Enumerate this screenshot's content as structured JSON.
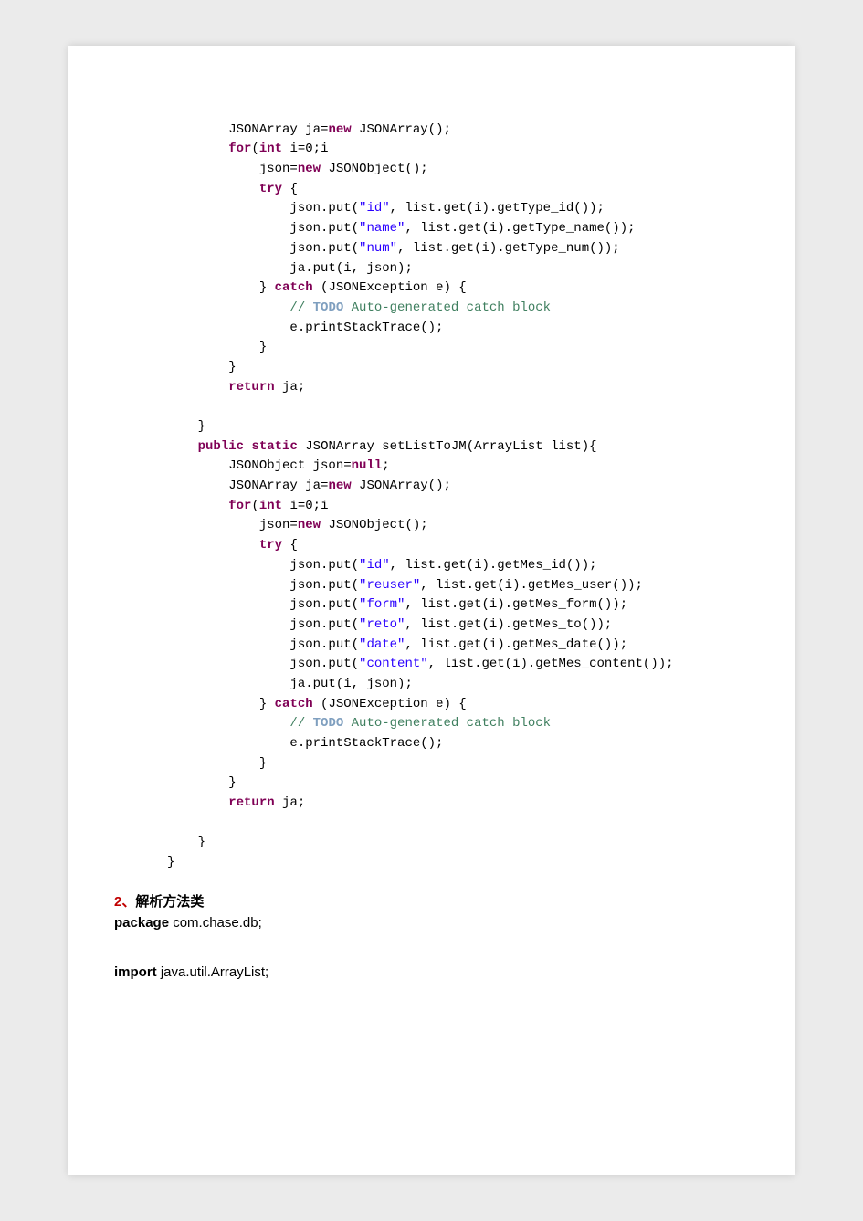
{
  "code1": {
    "indent2": "        ",
    "indent3": "            ",
    "indent4": "                ",
    "l01a": "JSONArray ja=",
    "l01b": "new",
    "l01c": " JSONArray();",
    "l02a": "for",
    "l02b": "(",
    "l02c": "int",
    "l02d": " i=0;i",
    "l03a": "json=",
    "l03b": "new",
    "l03c": " JSONObject();",
    "l04a": "try",
    "l04b": " {",
    "l05a": "json.put(",
    "l05b": "\"id\"",
    "l05c": ", list.get(i).getType_id());",
    "l06a": "json.put(",
    "l06b": "\"name\"",
    "l06c": ", list.get(i).getType_name());",
    "l07a": "json.put(",
    "l07b": "\"num\"",
    "l07c": ", list.get(i).getType_num());",
    "l08": "ja.put(i, json);",
    "l09a": "} ",
    "l09b": "catch",
    "l09c": " (JSONException e) {",
    "l10a": "// ",
    "l10b": "TODO",
    "l10c": " Auto-generated catch block",
    "l11": "e.printStackTrace();",
    "l12": "}",
    "l13": "}",
    "l14a": "return",
    "l14b": " ja;",
    "l16": "}",
    "m01a": "public",
    "m01b": " ",
    "m01c": "static",
    "m01d": " JSONArray setListToJM(ArrayList list){",
    "m02a": "JSONObject json=",
    "m02b": "null",
    "m02c": ";",
    "m03a": "JSONArray ja=",
    "m03b": "new",
    "m03c": " JSONArray();",
    "m04a": "for",
    "m04b": "(",
    "m04c": "int",
    "m04d": " i=0;i",
    "m05a": "json=",
    "m05b": "new",
    "m05c": " JSONObject();",
    "m06a": "try",
    "m06b": " {",
    "m07a": "json.put(",
    "m07b": "\"id\"",
    "m07c": ", list.get(i).getMes_id());",
    "m08a": "json.put(",
    "m08b": "\"reuser\"",
    "m08c": ", list.get(i).getMes_user());",
    "m09a": "json.put(",
    "m09b": "\"form\"",
    "m09c": ", list.get(i).getMes_form());",
    "m10a": "json.put(",
    "m10b": "\"reto\"",
    "m10c": ", list.get(i).getMes_to());",
    "m11a": "json.put(",
    "m11b": "\"date\"",
    "m11c": ", list.get(i).getMes_date());",
    "m12a": "json.put(",
    "m12b": "\"content\"",
    "m12c": ", list.get(i).getMes_content());",
    "m13": "ja.put(i, json);",
    "m14a": "} ",
    "m14b": "catch",
    "m14c": " (JSONException e) {",
    "m15a": "// ",
    "m15b": "TODO",
    "m15c": " Auto-generated catch block",
    "m16": "e.printStackTrace();",
    "m17": "}",
    "m18": "}",
    "m19a": "return",
    "m19b": " ja;",
    "m21": "}",
    "closeClass": "}"
  },
  "section": {
    "num": "2、",
    "title": "解析方法类",
    "pkg_kw": "package",
    "pkg_val": "  com.chase.db;",
    "imp_kw": "import",
    "imp_val": "  java.util.ArrayList;"
  }
}
